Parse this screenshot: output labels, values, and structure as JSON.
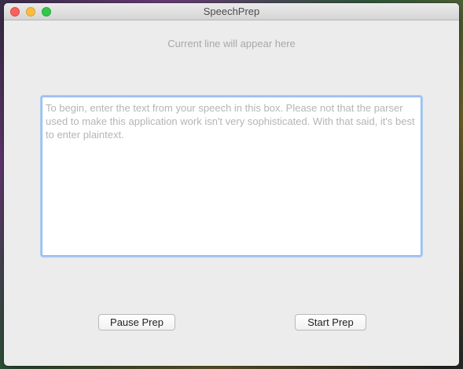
{
  "window": {
    "title": "SpeechPrep"
  },
  "main": {
    "current_line": "Current line will appear here",
    "speech_input": {
      "value": "",
      "placeholder": "To begin, enter the text from your speech in this box. Please not that the parser used to make this application work isn't very sophisticated. With that said, it's best to enter plaintext."
    },
    "pause_button": "Pause Prep",
    "start_button": "Start Prep"
  },
  "colors": {
    "close": "#fc605c",
    "minimize": "#fdbc40",
    "zoom": "#34c84a",
    "focus_ring": "#8fb5ee"
  }
}
